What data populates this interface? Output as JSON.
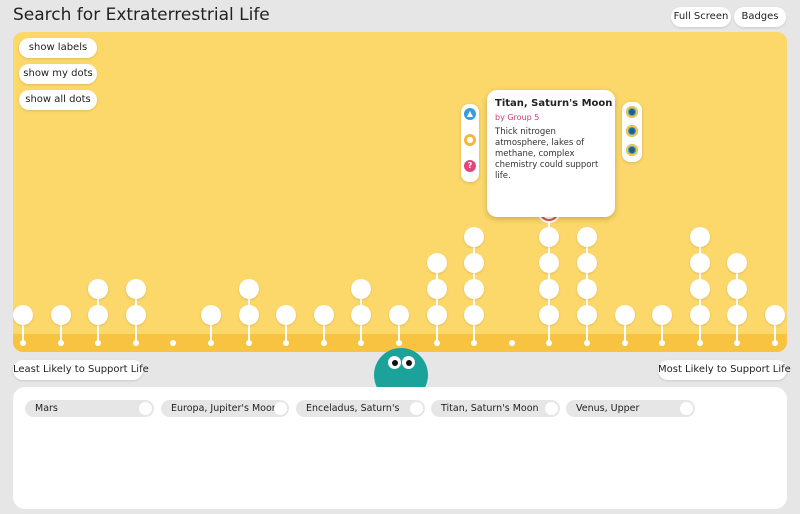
{
  "app": {
    "title": "Search for Extraterrestrial Life"
  },
  "header": {
    "fullscreen_label": "Full Screen",
    "badges_label": "Badges"
  },
  "controls": {
    "show_labels": "show labels",
    "show_my_dots": "show my dots",
    "show_all_dots": "show all dots"
  },
  "scale": {
    "least_label": "Least Likely to Support Life",
    "most_label": "Most Likely to Support Life"
  },
  "card": {
    "title": "Titan, Saturn's Moon",
    "by": "by Group 5",
    "description": "Thick nitrogen atmosphere, lakes of methane, complex chemistry could support life."
  },
  "icons": {
    "thumbs_up": "thumbs-up-icon",
    "lightbulb": "lightbulb-icon",
    "question": "question-icon",
    "rubric": "rubric-badge-icon"
  },
  "colors": {
    "panel": "#fcd76a",
    "track": "#f7c340",
    "mascot": "#1ba29a",
    "accent_red": "#e2553e",
    "group_link": "#d03a7a",
    "thumbs_blue": "#3a9bd6",
    "bulb_yellow": "#f4b73a",
    "question_pink": "#e0457b"
  },
  "dot_columns": [
    1,
    1,
    2,
    2,
    0,
    1,
    2,
    1,
    1,
    2,
    1,
    3,
    4,
    0,
    5,
    4,
    1,
    1,
    4,
    3,
    1
  ],
  "choices": [
    {
      "label": "Mars"
    },
    {
      "label": "Europa, Jupiter's Moon"
    },
    {
      "label": "Enceladus, Saturn's"
    },
    {
      "label": "Titan, Saturn's Moon"
    },
    {
      "label": "Venus, Upper"
    }
  ]
}
